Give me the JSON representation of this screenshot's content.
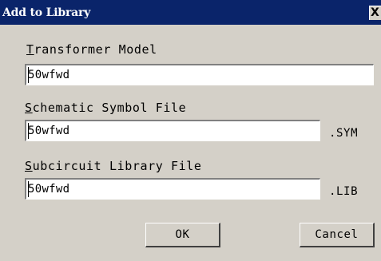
{
  "window": {
    "title": "Add to Library",
    "close_glyph": "X"
  },
  "fields": {
    "transformer_model": {
      "label_first": "T",
      "label_rest": "ransformer Model",
      "value": "50wfwd"
    },
    "schematic_symbol": {
      "label_first": "S",
      "label_rest": "chematic Symbol File",
      "value": "50wfwd",
      "extension": ".SYM"
    },
    "subcircuit_library": {
      "label_first": "S",
      "label_rest": "ubcircuit Library File",
      "value": "50wfwd",
      "extension": ".LIB"
    }
  },
  "buttons": {
    "ok_label": "OK",
    "cancel_label": "Cancel"
  }
}
